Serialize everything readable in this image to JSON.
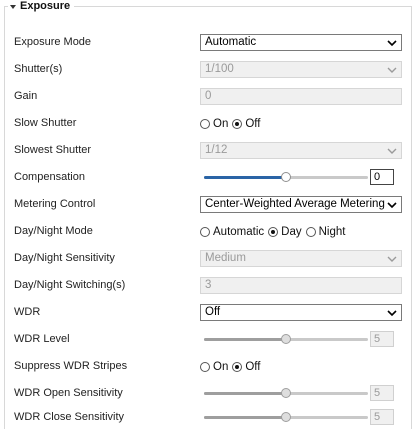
{
  "section": {
    "title": "Exposure"
  },
  "colors": {
    "accent": "#2a64a6",
    "border": "#d8d8d8",
    "disabled_bg": "#f0f0f0"
  },
  "fields": {
    "exposure_mode": {
      "label": "Exposure Mode",
      "value": "Automatic"
    },
    "shutter": {
      "label": "Shutter(s)",
      "value": "1/100"
    },
    "gain": {
      "label": "Gain",
      "value": "0"
    },
    "slow_shutter": {
      "label": "Slow Shutter",
      "options": [
        "On",
        "Off"
      ],
      "selected": "Off"
    },
    "slowest_shutter": {
      "label": "Slowest Shutter",
      "value": "1/12"
    },
    "compensation": {
      "label": "Compensation",
      "value": "0",
      "level": 0.5
    },
    "metering_control": {
      "label": "Metering Control",
      "value": "Center-Weighted Average Metering"
    },
    "day_night_mode": {
      "label": "Day/Night Mode",
      "options": [
        "Automatic",
        "Day",
        "Night"
      ],
      "selected": "Day"
    },
    "day_night_sensitivity": {
      "label": "Day/Night Sensitivity",
      "value": "Medium"
    },
    "day_night_switching": {
      "label": "Day/Night Switching(s)",
      "value": "3"
    },
    "wdr": {
      "label": "WDR",
      "value": "Off"
    },
    "wdr_level": {
      "label": "WDR Level",
      "value": "5",
      "level": 0.5
    },
    "suppress_wdr_stripes": {
      "label": "Suppress WDR Stripes",
      "options": [
        "On",
        "Off"
      ],
      "selected": "Off"
    },
    "wdr_open_sensitivity": {
      "label": "WDR Open Sensitivity",
      "value": "5",
      "level": 0.5
    },
    "wdr_close_sensitivity": {
      "label": "WDR Close Sensitivity",
      "value": "5",
      "level": 0.5
    }
  }
}
